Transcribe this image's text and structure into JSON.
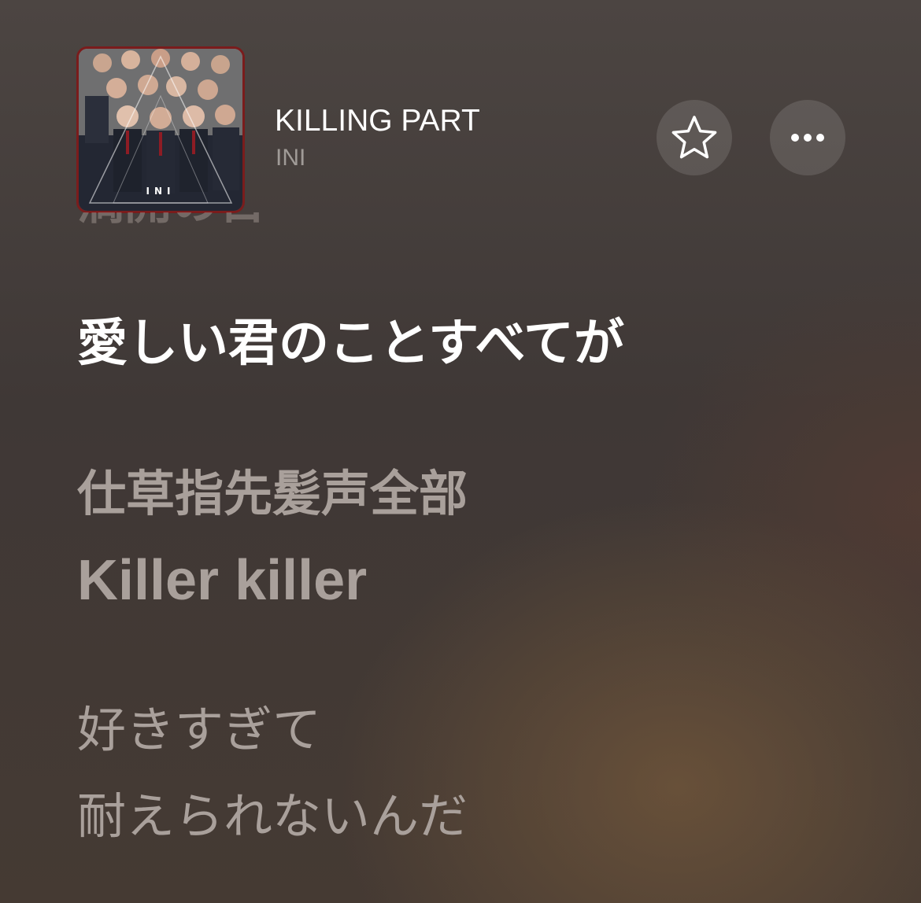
{
  "now_playing": {
    "title": "KILLING PART",
    "artist": "INI",
    "artwork": {
      "label": "INI",
      "border_color": "#7a1c1c"
    }
  },
  "actions": {
    "favorite_icon": "star-outline-icon",
    "more_icon": "ellipsis-icon"
  },
  "lyrics": {
    "previous_line": "満開の日",
    "current_line": "愛しい君のことすべてが",
    "upcoming": [
      {
        "lines": [
          "仕草指先髪声全部",
          "Killer killer"
        ]
      },
      {
        "lines": [
          "好きすぎて",
          "耐えられないんだ"
        ]
      }
    ]
  },
  "colors": {
    "active_lyric": "#ffffff",
    "inactive_lyric": "#a9a09b",
    "artist_text": "#a09b97"
  }
}
